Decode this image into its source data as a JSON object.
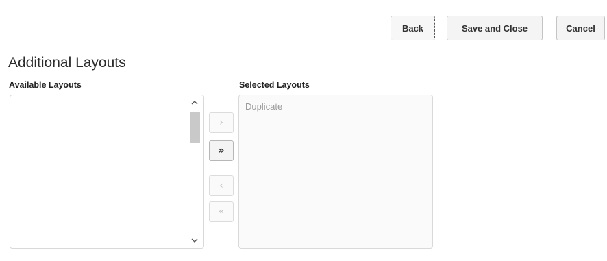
{
  "toolbar": {
    "back_label": "Back",
    "save_close_label": "Save and Close",
    "cancel_label": "Cancel"
  },
  "section": {
    "title": "Additional Layouts"
  },
  "available_layouts": {
    "label": "Available Layouts",
    "items": []
  },
  "selected_layouts": {
    "label": "Selected Layouts",
    "items": [
      "Duplicate"
    ]
  },
  "shuttle": {
    "move_right": "›",
    "move_all_right": "»",
    "move_left": "‹",
    "move_all_left": "«"
  },
  "scrollbar": {
    "up_arrow": "^",
    "down_arrow": "v"
  }
}
